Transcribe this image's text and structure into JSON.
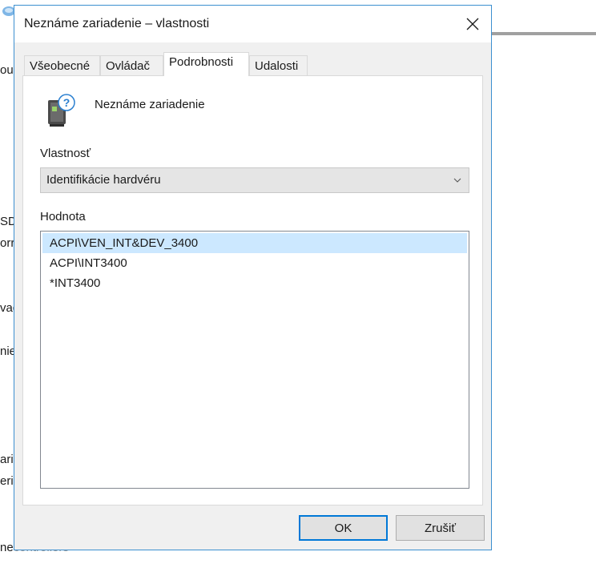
{
  "background": {
    "fragments": [
      "ou",
      "SD",
      "orr",
      "vad",
      "nie",
      "aria",
      "eric"
    ],
    "bottom_fragment_visible": "ne",
    "bottom_fragment_partial": "controllers"
  },
  "dialog": {
    "title": "Neznáme zariadenie – vlastnosti",
    "tabs": [
      {
        "label": "Všeobecné",
        "active": false
      },
      {
        "label": "Ovládač",
        "active": false
      },
      {
        "label": "Podrobnosti",
        "active": true
      },
      {
        "label": "Udalosti",
        "active": false
      }
    ],
    "device_name": "Neznáme zariadenie",
    "property_label": "Vlastnosť",
    "property_selected": "Identifikácie hardvéru",
    "value_label": "Hodnota",
    "values": [
      {
        "text": "ACPI\\VEN_INT&DEV_3400",
        "selected": true
      },
      {
        "text": "ACPI\\INT3400",
        "selected": false
      },
      {
        "text": "*INT3400",
        "selected": false
      }
    ],
    "ok_label": "OK",
    "cancel_label": "Zrušiť"
  },
  "colors": {
    "accent": "#0078d7",
    "selection": "#cce8ff",
    "dialog_border": "#3c8fd0"
  }
}
